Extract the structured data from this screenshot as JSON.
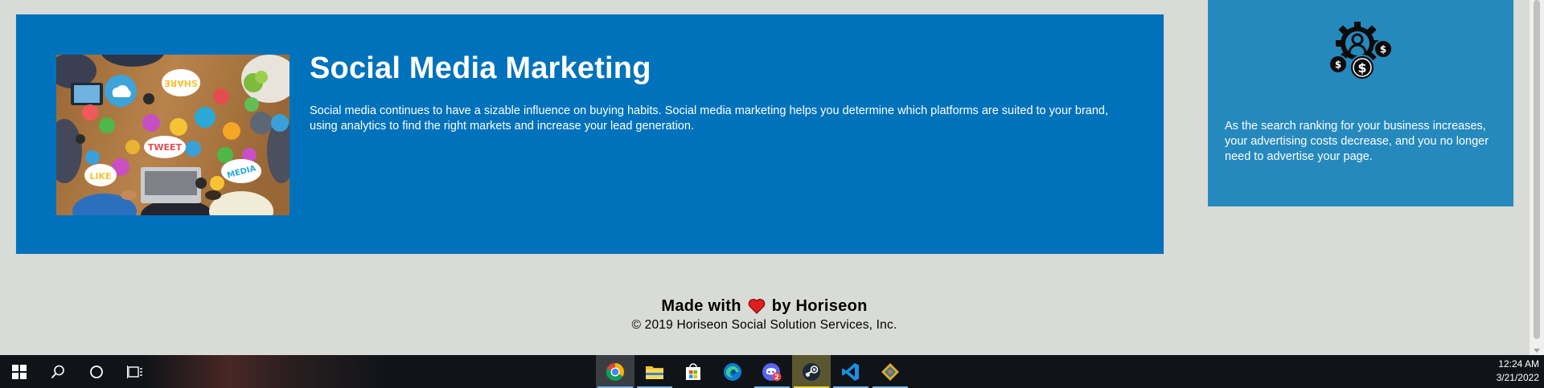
{
  "card": {
    "title": "Social Media Marketing",
    "text": "Social media continues to have a sizable influence on buying habits. Social media marketing helps you determine which platforms are suited to your brand, using analytics to find the right markets and increase your lead generation.",
    "image_icon": "social-media-photo",
    "image_words": [
      "SHARE",
      "TWEET",
      "LIKE",
      "MEDIA"
    ],
    "bg_color": "#0072bb"
  },
  "side": {
    "icon": "cost-management-icon",
    "text": "As the search ranking for your business increases, your advertising costs decrease, and you no longer need to advertise your page.",
    "bg_color": "#2589bd"
  },
  "footer": {
    "made_with": "Made with",
    "by": "by Horiseon",
    "copyright": "© 2019 Horiseon Social Solution Services, Inc.",
    "heart_color": "#e11d1d"
  },
  "taskbar": {
    "items": [
      {
        "name": "start",
        "icon": "windows-icon"
      },
      {
        "name": "search",
        "icon": "search-icon"
      },
      {
        "name": "cortana",
        "icon": "cortana-icon"
      },
      {
        "name": "task-view",
        "icon": "task-view-icon"
      },
      {
        "name": "chrome",
        "icon": "chrome-icon"
      },
      {
        "name": "file-explorer",
        "icon": "folder-icon"
      },
      {
        "name": "store",
        "icon": "store-icon"
      },
      {
        "name": "edge",
        "icon": "edge-icon"
      },
      {
        "name": "discord",
        "icon": "discord-icon",
        "badge": "2"
      },
      {
        "name": "steam",
        "icon": "steam-icon"
      },
      {
        "name": "vscode",
        "icon": "vscode-icon"
      },
      {
        "name": "git-kraken",
        "icon": "gitkraken-icon"
      }
    ],
    "time": "12:24 AM",
    "date": "3/21/2022"
  }
}
